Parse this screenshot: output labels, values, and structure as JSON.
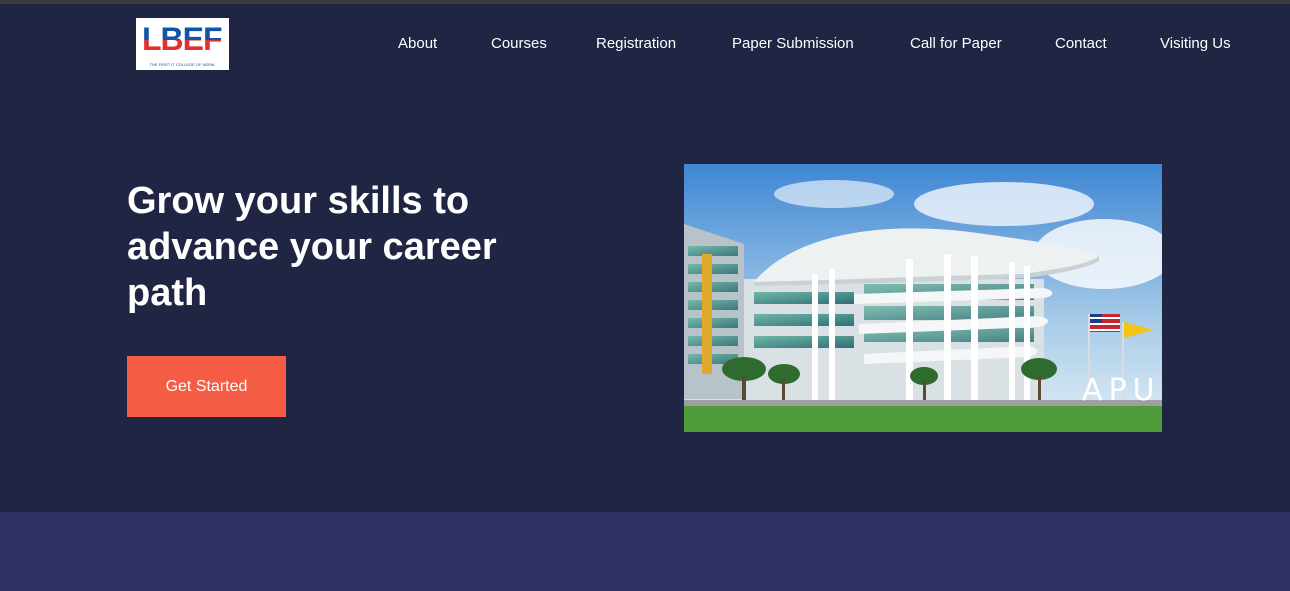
{
  "brand": {
    "logo_text": "LBEF",
    "logo_tagline": "THE FIRST IT COLLEGE OF NEPAL"
  },
  "nav": {
    "items": [
      {
        "label": "About"
      },
      {
        "label": "Courses"
      },
      {
        "label": "Registration"
      },
      {
        "label": "Paper Submission"
      },
      {
        "label": "Call for Paper"
      },
      {
        "label": "Contact"
      },
      {
        "label": "Visiting Us"
      }
    ]
  },
  "hero": {
    "title": "Grow your skills to advance your career path",
    "cta_label": "Get Started",
    "image_sign_text": "APU"
  },
  "colors": {
    "header_bg": "#1f2543",
    "band_bg": "#2d3061",
    "cta_bg": "#f45c43",
    "nav_text": "#ffffff"
  }
}
